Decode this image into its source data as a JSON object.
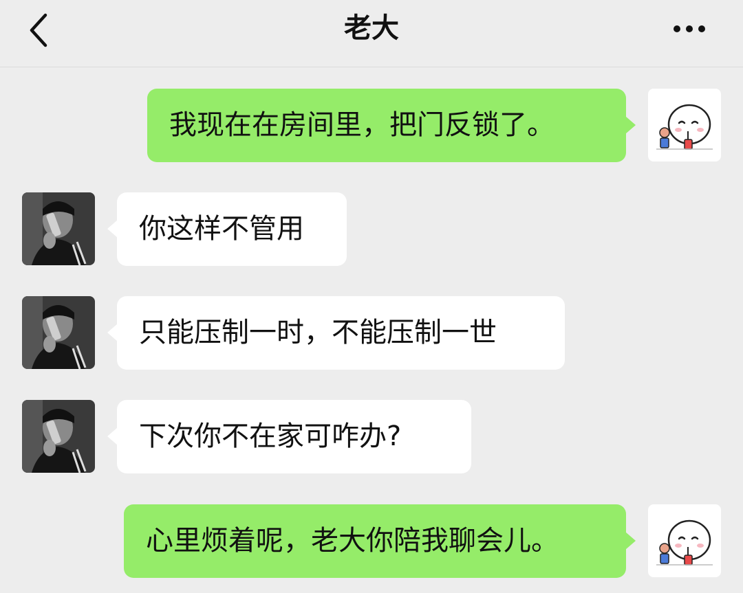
{
  "header": {
    "title": "老大",
    "back_icon": "chevron-left-icon",
    "more_icon": "more-dots-icon"
  },
  "messages": [
    {
      "side": "right",
      "text": "我现在在房间里，把门反锁了。"
    },
    {
      "side": "left",
      "text": "你这样不管用"
    },
    {
      "side": "left",
      "text": "只能压制一时，不能压制一世"
    },
    {
      "side": "left",
      "text": "下次你不在家可咋办?"
    },
    {
      "side": "right",
      "text": "心里烦着呢，老大你陪我聊会儿。"
    }
  ],
  "colors": {
    "background": "#ededed",
    "self_bubble": "#95ec69",
    "other_bubble": "#ffffff"
  }
}
